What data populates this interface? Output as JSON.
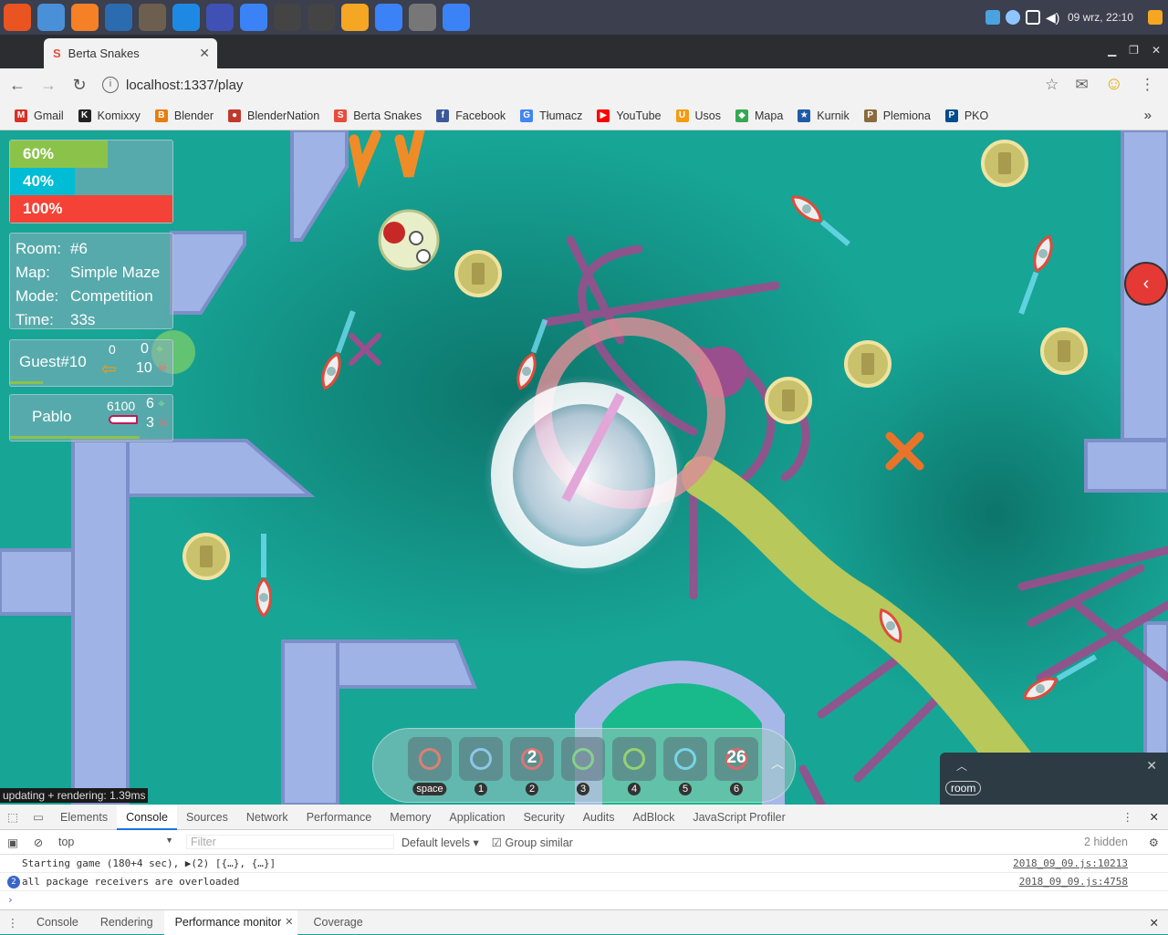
{
  "taskbar": {
    "apps": [
      {
        "name": "ubuntu-icon",
        "color": "#e95420"
      },
      {
        "name": "chromium-icon",
        "color": "#4a90d9"
      },
      {
        "name": "sublime-s-icon",
        "color": "#f58025"
      },
      {
        "name": "blender-icon",
        "color": "#2b6cb0"
      },
      {
        "name": "gimp-icon",
        "color": "#6d5f4f"
      },
      {
        "name": "smiley-icon",
        "color": "#1e88e5"
      },
      {
        "name": "files-icon",
        "color": "#3f51b5"
      },
      {
        "name": "chrome-icon",
        "color": "#3b82f6"
      },
      {
        "name": "sublime-icon",
        "color": "#444"
      },
      {
        "name": "terminal-icon",
        "color": "#444"
      },
      {
        "name": "folder-icon",
        "color": "#f5a623"
      },
      {
        "name": "chrome2-icon",
        "color": "#3b82f6"
      },
      {
        "name": "settings-gear-icon",
        "color": "#777"
      },
      {
        "name": "chrome-active-icon",
        "color": "#3b82f6"
      }
    ],
    "clock": "09 wrz, 22:10"
  },
  "browser": {
    "tab_title": "Berta Snakes",
    "url": "localhost:1337/play",
    "bookmarks": [
      {
        "label": "Gmail",
        "icon": "gmail-icon",
        "color": "#d93025",
        "glyph": "M"
      },
      {
        "label": "Komixxy",
        "icon": "komixxy-icon",
        "color": "#222",
        "glyph": "K"
      },
      {
        "label": "Blender",
        "icon": "blender-icon",
        "color": "#e87d0d",
        "glyph": "B"
      },
      {
        "label": "BlenderNation",
        "icon": "blendernation-icon",
        "color": "#c0392b",
        "glyph": "●"
      },
      {
        "label": "Berta Snakes",
        "icon": "berta-snakes-icon",
        "color": "#e74c3c",
        "glyph": "S"
      },
      {
        "label": "Facebook",
        "icon": "facebook-icon",
        "color": "#3b5998",
        "glyph": "f"
      },
      {
        "label": "Tłumacz",
        "icon": "translate-icon",
        "color": "#4285f4",
        "glyph": "G"
      },
      {
        "label": "YouTube",
        "icon": "youtube-icon",
        "color": "#ff0000",
        "glyph": "▶"
      },
      {
        "label": "Usos",
        "icon": "usos-icon",
        "color": "#f39c12",
        "glyph": "U"
      },
      {
        "label": "Mapa",
        "icon": "maps-icon",
        "color": "#34a853",
        "glyph": "◆"
      },
      {
        "label": "Kurnik",
        "icon": "kurnik-icon",
        "color": "#1e5aa8",
        "glyph": "★"
      },
      {
        "label": "Plemiona",
        "icon": "plemiona-icon",
        "color": "#8b6b3d",
        "glyph": "P"
      },
      {
        "label": "PKO",
        "icon": "pko-icon",
        "color": "#004c8c",
        "glyph": "P"
      }
    ]
  },
  "hud": {
    "bars": [
      {
        "label": "60%",
        "value": 0.6,
        "color": "#8bc34a"
      },
      {
        "label": "40%",
        "value": 0.4,
        "color": "#00bcd4"
      },
      {
        "label": "100%",
        "value": 1.0,
        "color": "#f44336"
      }
    ],
    "room": {
      "room_label": "Room:",
      "room_value": "#6",
      "map_label": "Map:",
      "map_value": "Simple Maze",
      "mode_label": "Mode:",
      "mode_value": "Competition",
      "time_label": "Time:",
      "time_value": "33s"
    },
    "players": [
      {
        "name": "Guest#10",
        "points": "0",
        "kills": "0",
        "deaths": "10",
        "accent": "#ff9800"
      },
      {
        "name": "Pablo",
        "points": "6100",
        "kills": "6",
        "deaths": "3",
        "accent": "#e91e63"
      }
    ],
    "perf": "updating + rendering: 1.39ms"
  },
  "abilities": [
    {
      "key": "space",
      "count": "",
      "name": "rocket-burst-ability"
    },
    {
      "key": "1",
      "count": "",
      "name": "shot-ability"
    },
    {
      "key": "2",
      "count": "2",
      "name": "bomb-ability"
    },
    {
      "key": "3",
      "count": "",
      "name": "shield-ability"
    },
    {
      "key": "4",
      "count": "",
      "name": "syringe-ability"
    },
    {
      "key": "5",
      "count": "",
      "name": "speed-ability"
    },
    {
      "key": "6",
      "count": "26",
      "name": "target-ability"
    }
  ],
  "room_panel": {
    "label": "room"
  },
  "devtools": {
    "tabs": [
      "Elements",
      "Console",
      "Sources",
      "Network",
      "Performance",
      "Memory",
      "Application",
      "Security",
      "Audits",
      "AdBlock",
      "JavaScript Profiler"
    ],
    "active_tab": "Console",
    "context": "top",
    "filter_placeholder": "Filter",
    "levels": "Default levels",
    "group_similar": "Group similar",
    "hidden": "2 hidden",
    "logs": [
      {
        "text": "Starting game (180+4 sec), ▶(2) [{…}, {…}]",
        "source": "2018_09_09.js:10213",
        "badge": ""
      },
      {
        "text": "all package receivers are overloaded",
        "source": "2018_09_09.js:4758",
        "badge": "2"
      }
    ],
    "drawer_tabs": [
      "Console",
      "Rendering",
      "Performance monitor",
      "Coverage"
    ],
    "drawer_active": "Performance monitor"
  }
}
